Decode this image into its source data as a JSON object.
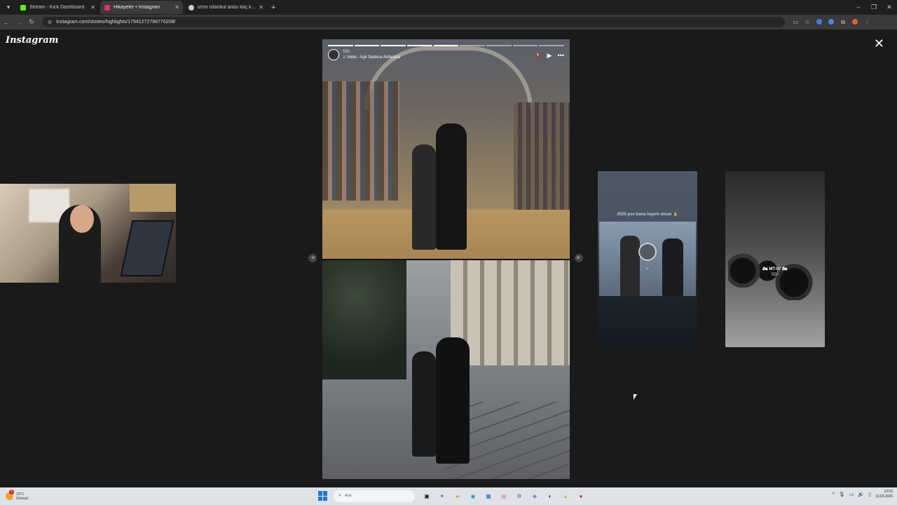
{
  "browser": {
    "tabs": [
      {
        "title": "Stream - Kick Dashboard",
        "favicon_color": "#53fc18",
        "active": false
      },
      {
        "title": "Hikayeler • Instagram",
        "favicon_color": "#e1306c",
        "active": true
      },
      {
        "title": "izmir istanbul arası kaç km - Go",
        "favicon_color": "#cccccc",
        "active": false
      }
    ],
    "new_tab": "+",
    "url": "instagram.com/stories/highlights/17941272788776208/",
    "window_controls": {
      "minimize": "–",
      "restore": "❐",
      "close": "✕"
    }
  },
  "instagram": {
    "logo": "Instagram",
    "close_icon": "✕"
  },
  "story": {
    "progress_segments": 9,
    "progress_done": 5,
    "time": "55h",
    "music": "♫ Velet - Aşk Sadece Anlarana",
    "controls": {
      "mute": "🔇",
      "play": "▶",
      "more": "•••"
    }
  },
  "previews": [
    {
      "caption": "2025 pcx bana hayırlı olsun 🙏",
      "label": "",
      "sublabel": "8h"
    },
    {
      "caption": "",
      "label": "🏍 MT-07 🏍",
      "sublabel": "55h"
    }
  ],
  "taskbar": {
    "weather_temp": "13°C",
    "weather_desc": "Güneşli",
    "weather_badge": "1",
    "search_placeholder": "Ara",
    "time": "12:52",
    "date": "13.03.2026"
  },
  "colors": {
    "page_bg": "#1a1a1a",
    "tab_active": "#3a3a3a",
    "taskbar_bg": "#dfe3e8",
    "start_blue": "#1e78d4"
  }
}
